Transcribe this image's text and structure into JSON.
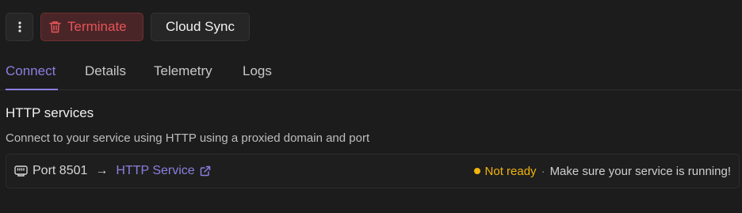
{
  "toolbar": {
    "more_icon": "vertical-dots-icon",
    "terminate_label": "Terminate",
    "terminate_icon": "trash-icon",
    "cloud_sync_label": "Cloud Sync"
  },
  "tabs": [
    {
      "label": "Connect",
      "active": true
    },
    {
      "label": "Details",
      "active": false
    },
    {
      "label": "Telemetry",
      "active": false
    },
    {
      "label": "Logs",
      "active": false
    }
  ],
  "section": {
    "title": "HTTP services",
    "description": "Connect to your service using HTTP using a proxied domain and port"
  },
  "service": {
    "port_icon": "ethernet-port-icon",
    "port_label": "Port 8501",
    "arrow": "→",
    "link_label": "HTTP Service",
    "link_icon": "external-link-icon",
    "status_label": "Not ready",
    "separator": "·",
    "status_message": "Make sure your service is running!"
  },
  "colors": {
    "accent": "#8b7fe0",
    "danger": "#e5545a",
    "warning": "#f2b40c",
    "background": "#1c1c1c"
  }
}
